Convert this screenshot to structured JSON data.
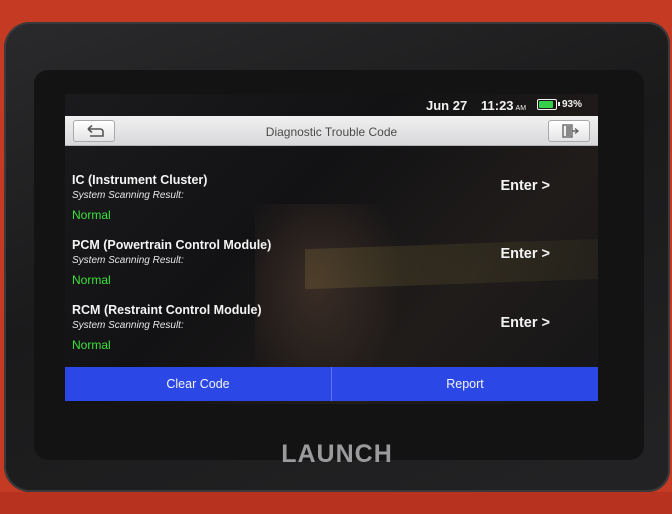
{
  "status_bar": {
    "date": "Jun 27",
    "time": "11:23",
    "ampm": "AM",
    "battery_text": "93%",
    "battery_level": 0.93,
    "battery_icon": "battery-icon"
  },
  "header": {
    "title": "Diagnostic Trouble Code",
    "back_icon": "back-arrow-icon",
    "exit_icon": "exit-icon"
  },
  "modules": [
    {
      "name": "IC (Instrument Cluster)",
      "subtitle": "System Scanning Result:",
      "status": "Normal",
      "action": "Enter >"
    },
    {
      "name": "PCM (Powertrain Control Module)",
      "subtitle": "System Scanning Result:",
      "status": "Normal",
      "action": "Enter >"
    },
    {
      "name": "RCM (Restraint Control Module)",
      "subtitle": "System Scanning Result:",
      "status": "Normal",
      "action": "Enter >"
    }
  ],
  "footer": {
    "clear_label": "Clear Code",
    "report_label": "Report"
  },
  "device": {
    "brand": "LAUNCH"
  },
  "colors": {
    "accent": "#2b48e6",
    "status_normal": "#3ce23c",
    "device_casing": "#c43a22"
  }
}
